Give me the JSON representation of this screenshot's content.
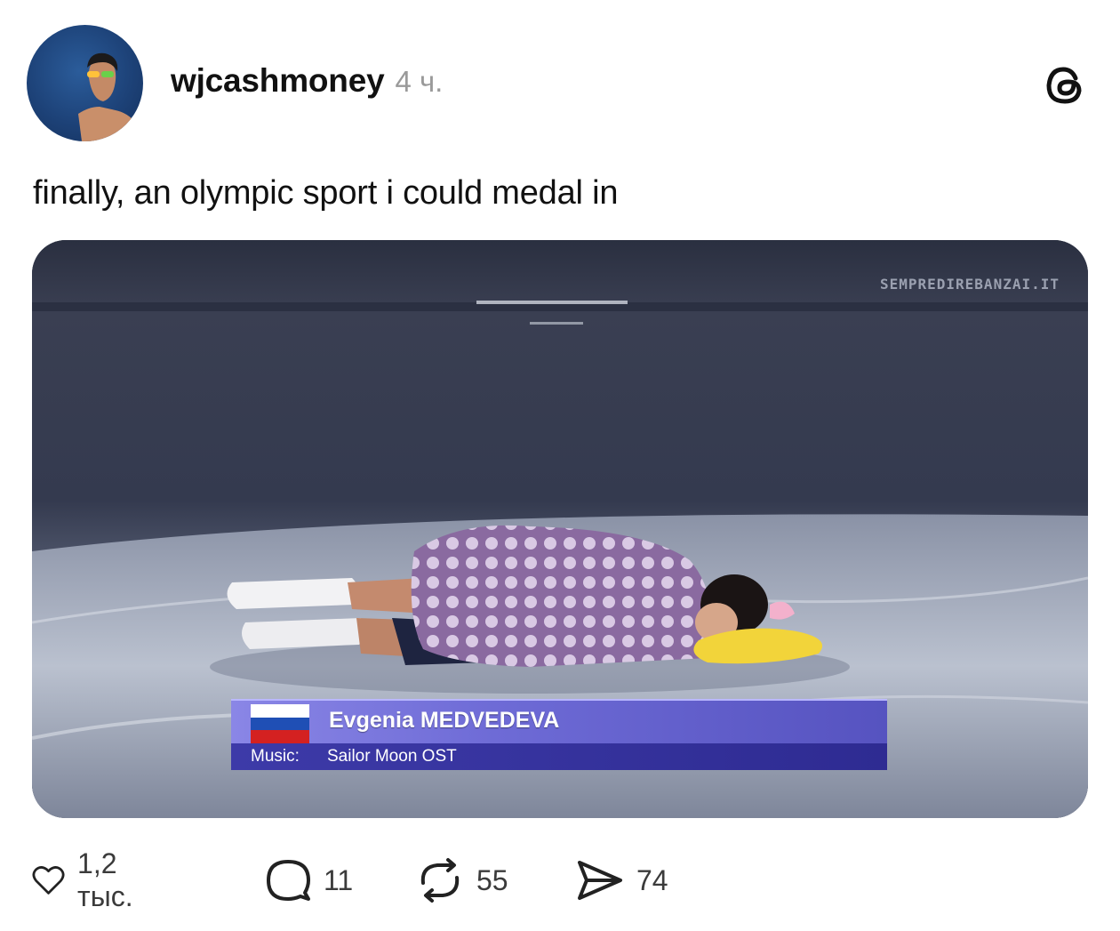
{
  "post": {
    "username": "wjcashmoney",
    "time": "4 ч.",
    "text": "finally, an olympic sport i could medal in"
  },
  "media": {
    "watermark": "SEMPREDIREBANZAI.IT",
    "athlete_name": "Evgenia MEDVEDEVA",
    "music_label": "Music:",
    "music_value": "Sailor Moon OST",
    "flag_colors": [
      "#ffffff",
      "#1f4fb5",
      "#d42121"
    ]
  },
  "actions": {
    "likes": "1,2 тыс.",
    "replies": "11",
    "reposts": "55",
    "shares": "74"
  },
  "icons": [
    "threads-logo-icon",
    "heart-icon",
    "comment-icon",
    "repost-icon",
    "send-icon"
  ]
}
